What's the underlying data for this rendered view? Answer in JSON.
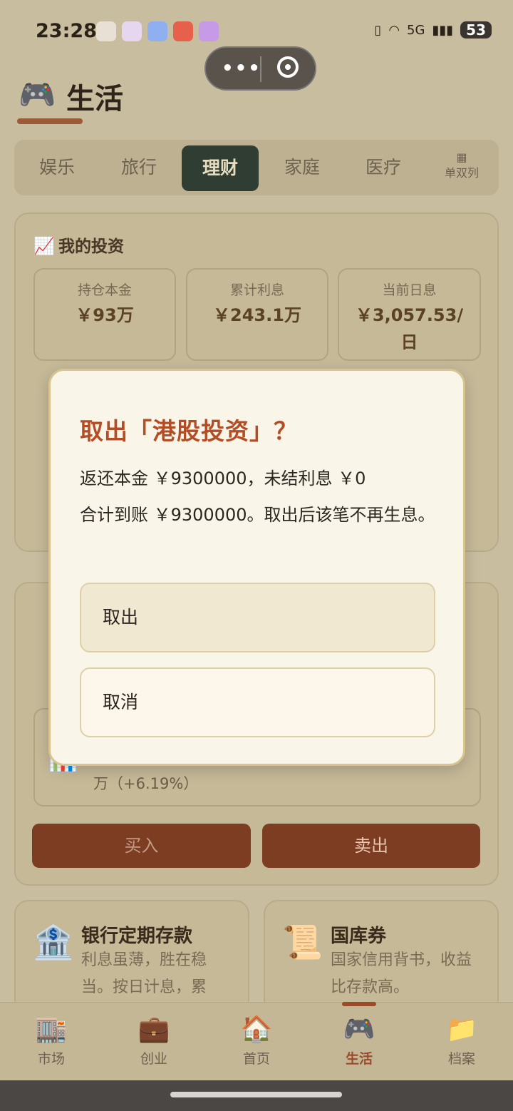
{
  "status_bar": {
    "time": "23:28",
    "battery": "53",
    "network": "5G"
  },
  "header": {
    "icon": "🎮",
    "title": "生活"
  },
  "tabs": {
    "items": [
      {
        "label": "娱乐"
      },
      {
        "label": "旅行"
      },
      {
        "label": "理财",
        "active": true
      },
      {
        "label": "家庭"
      },
      {
        "label": "医疗"
      }
    ],
    "layout_toggle": {
      "icon": "▦",
      "label": "单双列"
    }
  },
  "investments": {
    "title_icon": "📈",
    "title": "我的投资",
    "stats": [
      {
        "label": "持仓本金",
        "value": "￥93万"
      },
      {
        "label": "累计利息",
        "value": "￥243.1万"
      },
      {
        "label": "当前日息",
        "value": "￥3,057.53/日"
      }
    ]
  },
  "stock_card": {
    "detail_partial": "万（+6.19%）",
    "buy_label": "买入",
    "sell_label": "卖出"
  },
  "products": [
    {
      "icon": "🏦",
      "name": "银行定期存款",
      "desc": "利息虽薄，胜在稳当。按日计息，累"
    },
    {
      "icon": "📜",
      "name": "国库券",
      "desc": "国家信用背书，收益比存款高。"
    }
  ],
  "bottom_nav": [
    {
      "icon": "🏬",
      "label": "市场"
    },
    {
      "icon": "💼",
      "label": "创业"
    },
    {
      "icon": "🏠",
      "label": "首页"
    },
    {
      "icon": "🎮",
      "label": "生活",
      "active": true
    },
    {
      "icon": "📁",
      "label": "档案"
    }
  ],
  "modal": {
    "title": "取出「港股投资」？",
    "line1": "返还本金 ￥9300000，未结利息 ￥0",
    "line2": "合计到账 ￥9300000。取出后该笔不再生息。",
    "confirm_label": "取出",
    "cancel_label": "取消"
  },
  "colors": {
    "accent": "#b34d26",
    "active_tab": "#2f3d33",
    "button": "#7c3d22"
  }
}
